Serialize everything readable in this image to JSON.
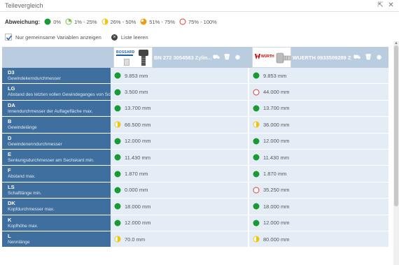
{
  "window": {
    "title": "Teilevergleich"
  },
  "legend": {
    "label": "Abweichung:",
    "items": [
      {
        "text": "0%",
        "type": "full",
        "color": "#1a9a34"
      },
      {
        "text": "1% - 25%",
        "type": "quarter",
        "color": "#7dc241"
      },
      {
        "text": "26% - 50%",
        "type": "half",
        "color": "#f1c40f"
      },
      {
        "text": "51% - 75%",
        "type": "threequarter",
        "color": "#f39c12"
      },
      {
        "text": "75% - 100%",
        "type": "empty",
        "color": "#e53935"
      }
    ]
  },
  "options": {
    "common_vars_label": "Nur gemeinsame Variablen anzeigen",
    "common_vars_checked": true,
    "clear_list_label": "Liste leeren"
  },
  "products": [
    {
      "brand": "BOSSARD",
      "name": "BN 272 3054583 Zylin...",
      "brand_color": "#1e5fa8"
    },
    {
      "brand": "WÜRTH",
      "name": "WUERTH 0933509289 Zy...",
      "brand_color": "#cc0000"
    }
  ],
  "rows": [
    {
      "code": "D3",
      "desc": "Gewindekerndurchmesser",
      "v1": "9.853 mm",
      "s1": "full",
      "v2": "9.853 mm",
      "s2": "full"
    },
    {
      "code": "LG",
      "desc": "Abstand des letzten vollen Gewindeganges von Schaftlänge) max.",
      "v1": "3.500 mm",
      "s1": "full",
      "v2": "44.000 mm",
      "s2": "empty"
    },
    {
      "code": "DA",
      "desc": "Innendurchmesser der Auflagefläche max.",
      "v1": "13.700 mm",
      "s1": "full",
      "v2": "13.700 mm",
      "s2": "full"
    },
    {
      "code": "B",
      "desc": "Gewindelänge",
      "v1": "66.500 mm",
      "s1": "half",
      "v2": "36.000 mm",
      "s2": "half"
    },
    {
      "code": "D",
      "desc": "Gewindenenndurchmesser",
      "v1": "12.000 mm",
      "s1": "full",
      "v2": "12.000 mm",
      "s2": "full"
    },
    {
      "code": "E",
      "desc": "Senkungsdurchmesser am Sechskant min.",
      "v1": "11.430 mm",
      "s1": "full",
      "v2": "11.430 mm",
      "s2": "full"
    },
    {
      "code": "F",
      "desc": "Abstand max.",
      "v1": "1.870 mm",
      "s1": "full",
      "v2": "1.870 mm",
      "s2": "full"
    },
    {
      "code": "LS",
      "desc": "Schaftlänge min.",
      "v1": "0.000 mm",
      "s1": "full",
      "v2": "35.250 mm",
      "s2": "empty"
    },
    {
      "code": "DK",
      "desc": "Kopfdurchmesser max.",
      "v1": "18.000 mm",
      "s1": "full",
      "v2": "18.000 mm",
      "s2": "full"
    },
    {
      "code": "K",
      "desc": "Kopfhöhe max.",
      "v1": "12.000 mm",
      "s1": "full",
      "v2": "12.000 mm",
      "s2": "full"
    },
    {
      "code": "L",
      "desc": "Nennlänge",
      "v1": "70.0 mm",
      "s1": "half",
      "v2": "80.000 mm",
      "s2": "half"
    }
  ]
}
